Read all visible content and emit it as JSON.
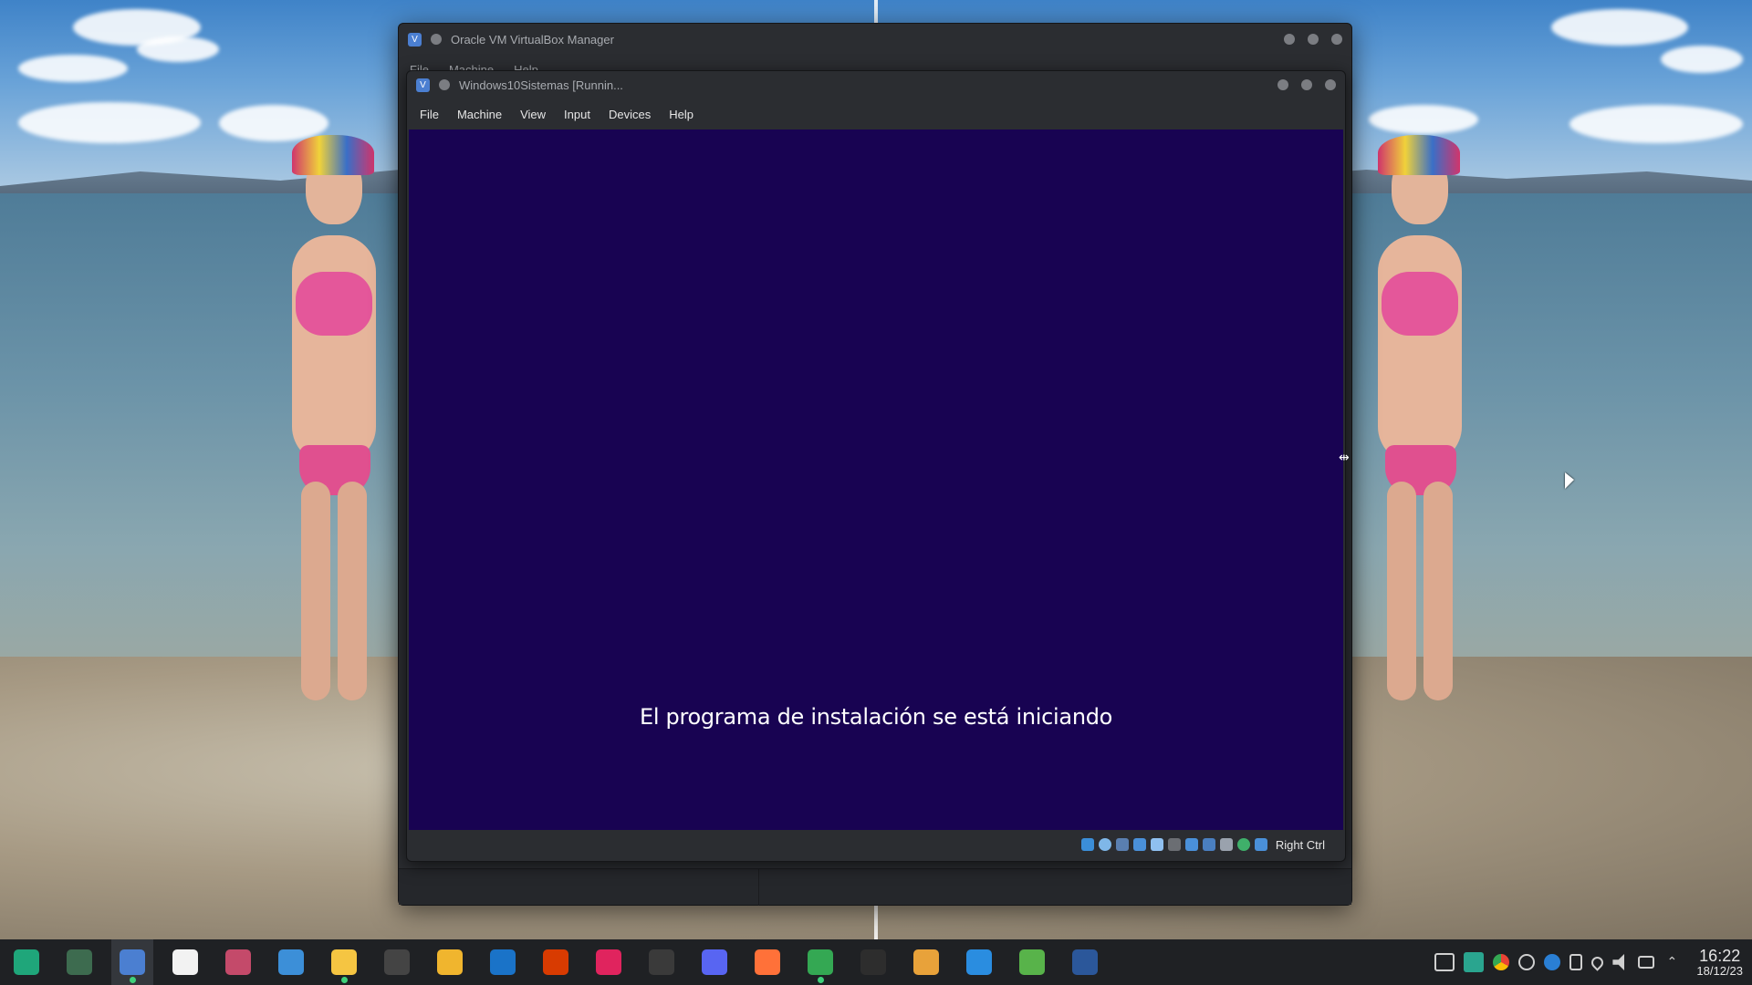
{
  "manager_window": {
    "title": "Oracle VM VirtualBox Manager",
    "menu": [
      "File",
      "Machine",
      "Help"
    ]
  },
  "vm_window": {
    "title": "Windows10Sistemas [Runnin...",
    "menu": [
      "File",
      "Machine",
      "View",
      "Input",
      "Devices",
      "Help"
    ],
    "screen_text": "El programa de instalación se está iniciando",
    "screen_color": "#180352",
    "status_icons": [
      "hard-disk-icon",
      "optical-disk-icon",
      "audio-icon",
      "network-icon",
      "usb-icon",
      "shared-folder-icon",
      "display-icon",
      "recording-icon",
      "cpu-icon",
      "mouse-integration-icon",
      "keyboard-icon"
    ],
    "host_key": "Right Ctrl"
  },
  "taskbar": {
    "apps": [
      {
        "name": "manjaro-menu-icon",
        "color": "#1fa67a",
        "active": false,
        "running": false
      },
      {
        "name": "system-monitor-icon",
        "color": "#3d6b4f",
        "active": false,
        "running": false
      },
      {
        "name": "virtualbox-icon",
        "color": "#4b7fd1",
        "active": true,
        "running": true
      },
      {
        "name": "software-store-icon",
        "color": "#f2f2f2",
        "active": false,
        "running": false
      },
      {
        "name": "video-player-icon",
        "color": "#c44a6a",
        "active": false,
        "running": false
      },
      {
        "name": "notes-icon",
        "color": "#3c8fd8",
        "active": false,
        "running": false
      },
      {
        "name": "file-manager-icon",
        "color": "#f5c542",
        "active": false,
        "running": true
      },
      {
        "name": "inkscape-icon",
        "color": "#444444",
        "active": false,
        "running": false
      },
      {
        "name": "folder-icon",
        "color": "#f0b52e",
        "active": false,
        "running": false
      },
      {
        "name": "outlook-icon",
        "color": "#1a73c8",
        "active": false,
        "running": false
      },
      {
        "name": "office-icon",
        "color": "#d83b01",
        "active": false,
        "running": false
      },
      {
        "name": "media-player-icon",
        "color": "#e0245e",
        "active": false,
        "running": false
      },
      {
        "name": "obs-icon",
        "color": "#3a3a3a",
        "active": false,
        "running": false
      },
      {
        "name": "discord-icon",
        "color": "#5865f2",
        "active": false,
        "running": false
      },
      {
        "name": "firefox-icon",
        "color": "#ff7139",
        "active": false,
        "running": false
      },
      {
        "name": "chrome-icon",
        "color": "#34a853",
        "active": false,
        "running": true
      },
      {
        "name": "terminal-icon",
        "color": "#2d2d2d",
        "active": false,
        "running": false
      },
      {
        "name": "archive-icon",
        "color": "#e8a23a",
        "active": false,
        "running": false
      },
      {
        "name": "vscode-icon",
        "color": "#2a8de0",
        "active": false,
        "running": false
      },
      {
        "name": "package-icon",
        "color": "#58b34a",
        "active": false,
        "running": false
      },
      {
        "name": "word-icon",
        "color": "#2b579a",
        "active": false,
        "running": false
      }
    ],
    "tray_icons": [
      "show-desktop-icon",
      "workspace-icon",
      "chrome-tray-icon",
      "sync-icon",
      "bluetooth-icon",
      "clipboard-icon",
      "location-icon",
      "volume-icon",
      "network-tray-icon",
      "expand-tray-icon"
    ],
    "clock": {
      "time": "16:22",
      "date": "18/12/23"
    }
  }
}
